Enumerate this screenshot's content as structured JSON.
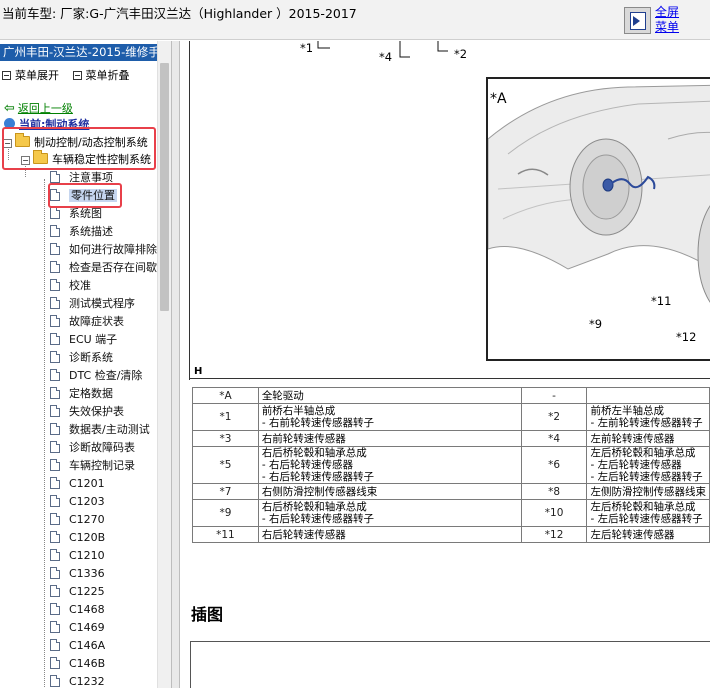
{
  "header": {
    "title": "当前车型:  厂家:G-广汽丰田汉兰达（Highlander ）2015-2017",
    "fullscreen_label": "全屏",
    "menu_label": "菜单"
  },
  "sidebar": {
    "header": "广州丰田-汉兰达-2015-维修手",
    "expand_label": "菜单展开",
    "collapse_label": "菜单折叠",
    "back_label": "返回上一级",
    "current_label": "当前:制动系统",
    "tree": {
      "level1": "制动控制/动态控制系统",
      "level2": "车辆稳定性控制系统",
      "items": [
        "注意事项",
        "零件位置",
        "系统图",
        "系统描述",
        "如何进行故障排除",
        "检查是否存在间歇",
        "校准",
        "测试模式程序",
        "故障症状表",
        "ECU 端子",
        "诊断系统",
        "DTC 检查/清除",
        "定格数据",
        "失效保护表",
        "数据表/主动测试",
        "诊断故障码表",
        "车辆控制记录",
        "C1201",
        "C1203",
        "C1270",
        "C120B",
        "C1210",
        "C1336",
        "C1225",
        "C1468",
        "C1469",
        "C146A",
        "C146B",
        "C1232"
      ],
      "selected_index": 1
    }
  },
  "figure": {
    "callouts": [
      "*1",
      "*4",
      "*2",
      "*9",
      "*11",
      "*12"
    ],
    "tag": "*A",
    "footer_mark": "H"
  },
  "legend": {
    "rows": [
      {
        "c1": "*A",
        "d1": [
          "全轮驱动"
        ],
        "c2": "-",
        "d2": [
          ""
        ]
      },
      {
        "c1": "*1",
        "d1": [
          "前桥右半轴总成",
          "- 右前轮转速传感器转子"
        ],
        "c2": "*2",
        "d2": [
          "前桥左半轴总成",
          "- 左前轮转速传感器转子"
        ]
      },
      {
        "c1": "*3",
        "d1": [
          "右前轮转速传感器"
        ],
        "c2": "*4",
        "d2": [
          "左前轮转速传感器"
        ]
      },
      {
        "c1": "*5",
        "d1": [
          "右后桥轮毂和轴承总成",
          "- 右后轮转速传感器",
          "- 右后轮转速传感器转子"
        ],
        "c2": "*6",
        "d2": [
          "左后桥轮毂和轴承总成",
          "- 左后轮转速传感器",
          "- 左后轮转速传感器转子"
        ]
      },
      {
        "c1": "*7",
        "d1": [
          "右侧防滑控制传感器线束"
        ],
        "c2": "*8",
        "d2": [
          "左侧防滑控制传感器线束"
        ]
      },
      {
        "c1": "*9",
        "d1": [
          "右后桥轮毂和轴承总成",
          "- 右后轮转速传感器转子"
        ],
        "c2": "*10",
        "d2": [
          "左后桥轮毂和轴承总成",
          "- 左后轮转速传感器转子"
        ]
      },
      {
        "c1": "*11",
        "d1": [
          "右后轮转速传感器"
        ],
        "c2": "*12",
        "d2": [
          "左后轮转速传感器"
        ]
      }
    ]
  },
  "section": {
    "title": "插图"
  }
}
